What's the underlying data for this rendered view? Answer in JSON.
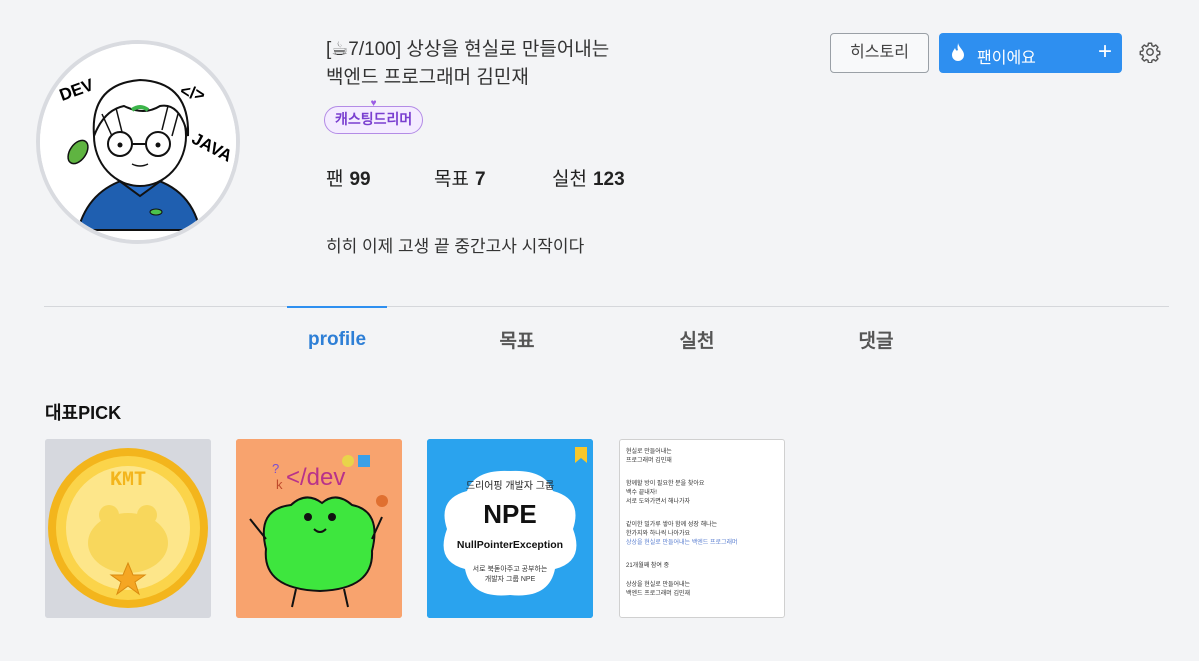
{
  "profile": {
    "title_line1": "[☕7/100] 상상을 현실로 만들어내는",
    "title_line2": "백엔드 프로그래머 김민재",
    "badge": "캐스팅드리머",
    "bio": "히히 이제 고생 끝 중간고사 시작이다",
    "avatar_text": {
      "dev": "DEV",
      "code": "</>",
      "java": "JAVA"
    }
  },
  "stats": [
    {
      "label": "팬",
      "value": "99"
    },
    {
      "label": "목표",
      "value": "7"
    },
    {
      "label": "실천",
      "value": "123"
    }
  ],
  "actions": {
    "history": "히스토리",
    "fan": "팬이에요",
    "fan_icon": "fire-icon",
    "plus": "+",
    "settings_icon": "gear-icon"
  },
  "tabs": [
    {
      "label": "profile",
      "active": true
    },
    {
      "label": "목표",
      "active": false
    },
    {
      "label": "실천",
      "active": false
    },
    {
      "label": "댓글",
      "active": false
    }
  ],
  "pick": {
    "title": "대표PICK",
    "cards": [
      {
        "kind": "pixel-coin",
        "text": "KMT"
      },
      {
        "kind": "frog-dev",
        "text": "</dev"
      },
      {
        "kind": "npe",
        "top": "드리어핑 개발자 그룹",
        "big": "NPE",
        "banner": "NullPointerException",
        "sub1": "서로 북돋아주고 공부하는",
        "sub2": "개발자 그룹 NPE"
      },
      {
        "kind": "screenshot-text",
        "lines": [
          "현실로 만들어내는",
          "프로그래머 김민재",
          "함께할 방이 필요한 분을 찾아요",
          "백수 끝내자!",
          "서로 도와가면서 해나가자",
          "같이한 밀가루 쌓아 함께 성장 해나는",
          "한가지와 하나씩 나아가요",
          "상상을 현실로 만들어내는 백엔드 프로그래머",
          "21개월째 참여 중",
          "상상을 현실로 만들어내는",
          "백엔드 프로그래머 김민재"
        ]
      }
    ]
  },
  "colors": {
    "accent": "#2e8ff0",
    "badge_border": "#b38be6",
    "badge_text": "#7a3fd0",
    "background": "#f3f4f6"
  }
}
